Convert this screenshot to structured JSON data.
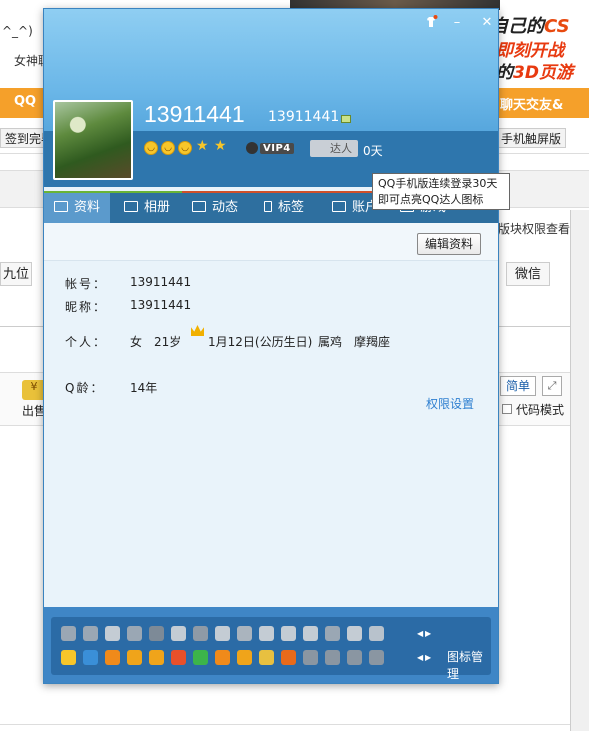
{
  "background_page": {
    "face_text": "^_^)",
    "link_text": "女神聊",
    "qq_tab": "QQ",
    "chat_tab": "聊天交友&",
    "signin_button": "签到完毕",
    "phone_button": "手机触屏版",
    "permission_text": "版块权限查看",
    "ninth_tab": "九位",
    "wechat_tab": "微信",
    "out_label": "出售",
    "simple_button": "简单",
    "code_mode_label": "代码模式"
  },
  "ad": {
    "line1_prefix": "自己的",
    "line1_brand": "CS",
    "line2": "即刻开战",
    "line3_prefix": "的",
    "line3_brand": "3D页游"
  },
  "profile": {
    "nickname": "13911441",
    "account_small": "13911441",
    "level_faces": 3,
    "level_stars": 2,
    "vip_label": "VIP4",
    "daren_label": "达人",
    "daren_days": "0天",
    "tooltip_line1": "QQ手机版连续登录30天",
    "tooltip_line2": "即可点亮QQ达人图标"
  },
  "tabs": [
    {
      "label": "资料",
      "icon": "card-icon"
    },
    {
      "label": "相册",
      "icon": "photo-icon"
    },
    {
      "label": "动态",
      "icon": "list-icon"
    },
    {
      "label": "标签",
      "icon": "bookmark-icon"
    },
    {
      "label": "账户",
      "icon": "briefcase-icon"
    },
    {
      "label": "游戏",
      "icon": "gamepad-icon"
    }
  ],
  "details": {
    "edit_button": "编辑资料",
    "account_label": "帐号：",
    "account_value": "13911441",
    "nick_label": "昵称：",
    "nick_value": "13911441",
    "personal_label": "个人：",
    "gender": "女",
    "age": "21岁",
    "birthday": "1月12日(公历生日)",
    "zodiac": "属鸡",
    "constellation": "摩羯座",
    "qage_label": "Q龄：",
    "qage_value": "14年",
    "permission_link": "权限设置"
  },
  "icon_manager": "图标管理",
  "colors": {
    "header_top": "#8fcef2",
    "header_dark": "#2e76ad",
    "tab_bar": "#2e6f9f",
    "active_tab": "#5b9acc",
    "link_blue": "#2e7fd0",
    "icon_panel": "#2b6ba6"
  }
}
